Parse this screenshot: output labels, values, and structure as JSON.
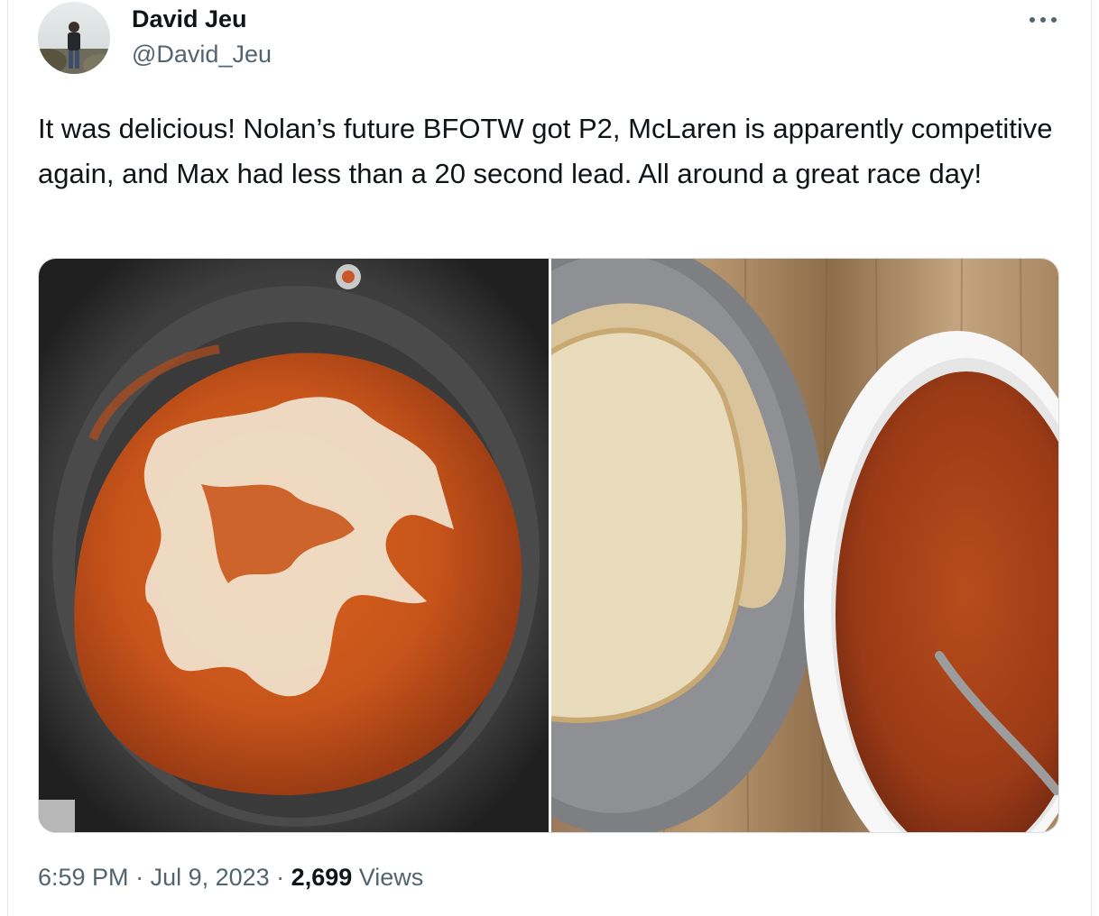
{
  "author": {
    "name": "David Jeu",
    "handle": "@David_Jeu"
  },
  "tweet": {
    "text": "It was delicious! Nolan’s future BFOTW got P2, McLaren is apparently competitive again, and Max had less than a 20 second lead. All around a great race day!"
  },
  "media": [
    {
      "description_icon": "photo-curry-pot"
    },
    {
      "description_icon": "photo-naan-and-bowl"
    }
  ],
  "meta": {
    "time": "6:59 PM",
    "separator": " · ",
    "date": "Jul 9, 2023",
    "views_count": "2,699",
    "views_label": " Views"
  },
  "colors": {
    "text": "#0f1419",
    "secondary": "#536471",
    "border": "#e6e9ec"
  }
}
